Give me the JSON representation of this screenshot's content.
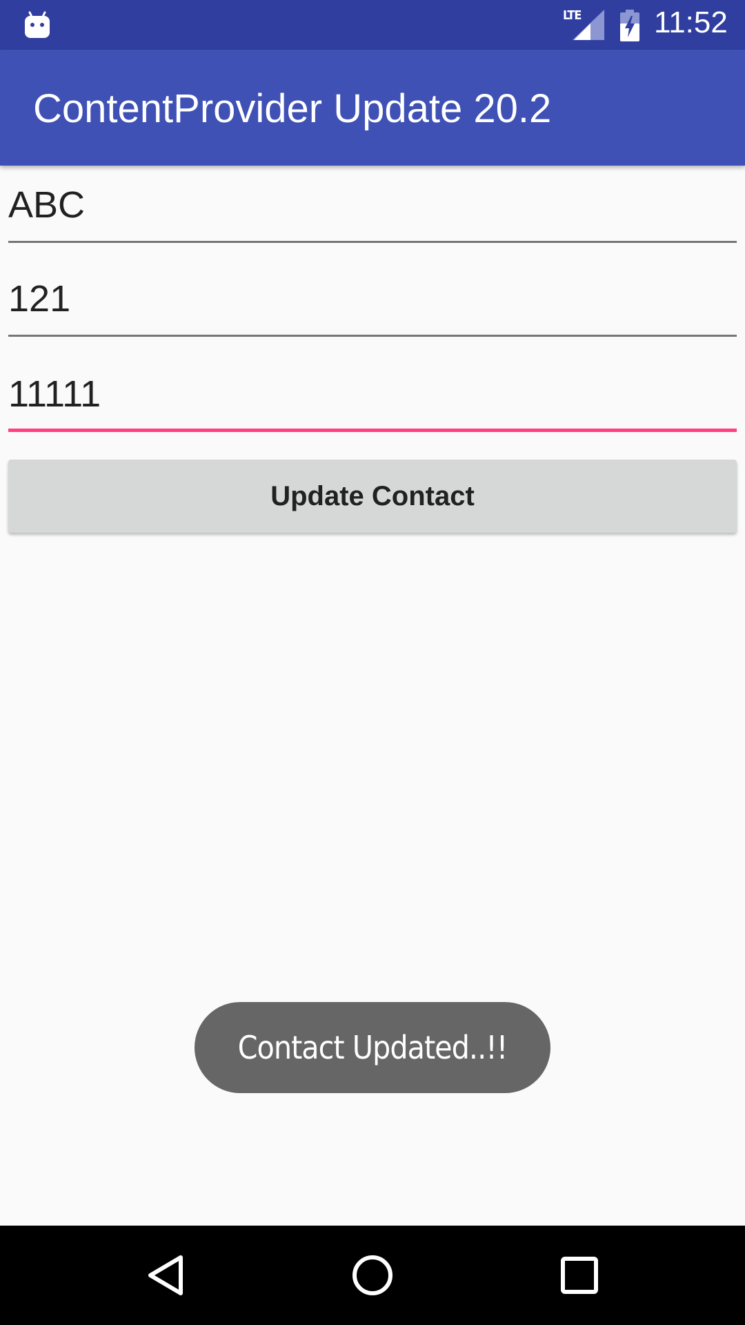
{
  "status_bar": {
    "time": "11:52",
    "network_label": "LTE",
    "icons": [
      "android-icon",
      "lte-signal-icon",
      "battery-charging-icon"
    ]
  },
  "app_bar": {
    "title": "ContentProvider Update 20.2"
  },
  "form": {
    "fields": [
      {
        "name": "name-field",
        "value": "ABC"
      },
      {
        "name": "id-field",
        "value": "121"
      },
      {
        "name": "phone-field",
        "value": "11111",
        "focused": true
      }
    ],
    "update_button_label": "Update Contact"
  },
  "toast": {
    "message": "Contact Updated..!!"
  },
  "colors": {
    "status_bar": "#303f9f",
    "app_bar": "#3f51b5",
    "accent": "#ff4081",
    "background": "#fafafa",
    "button": "#d6d7d7",
    "toast": "#666666",
    "nav_bar": "#000000"
  },
  "nav_bar": {
    "buttons": [
      "back-icon",
      "home-icon",
      "recents-icon"
    ]
  }
}
